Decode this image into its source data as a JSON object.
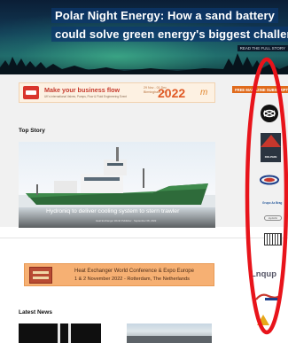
{
  "hero": {
    "line1": "Polar Night Energy: How a sand battery",
    "line2": "could solve green energy's biggest challenge",
    "read_more": "READ THE FULL STORY"
  },
  "ad_banner_1": {
    "headline": "Make your business flow",
    "subline": "UK's international Valves, Pumps, Flow & Fluid Engineering Event",
    "dates": "29 Nov - 01 Dec",
    "dates_sub": "Birmingham, UK",
    "year": "2022",
    "brand_mark": "m"
  },
  "cta_button": {
    "label": "FREE MAGAZINE SUBSCRIPTION"
  },
  "top_story": {
    "section_title": "Top Story",
    "headline": "Hydroniq to deliver cooling system to stern trawler",
    "meta": "Heat Exchanger World Publisher · September 08, 2022"
  },
  "ad_banner_2": {
    "line1": "Heat Exchanger World Conference & Expo Europe",
    "line2": "1 & 2 November 2022 - Rotterdam, The Netherlands"
  },
  "latest_news": {
    "section_title": "Latest News"
  },
  "sidebar": {
    "logo_dolphin": "DOLPHIN",
    "logo_blue_text": "Grupo Az Brag",
    "logo_pill": "Hydrofin",
    "logo_lnqup": "Lnqup"
  },
  "colors": {
    "accent_orange": "#e06b1c",
    "annotation_red": "#e8141b",
    "hero_text_bg": "#0c376e"
  }
}
